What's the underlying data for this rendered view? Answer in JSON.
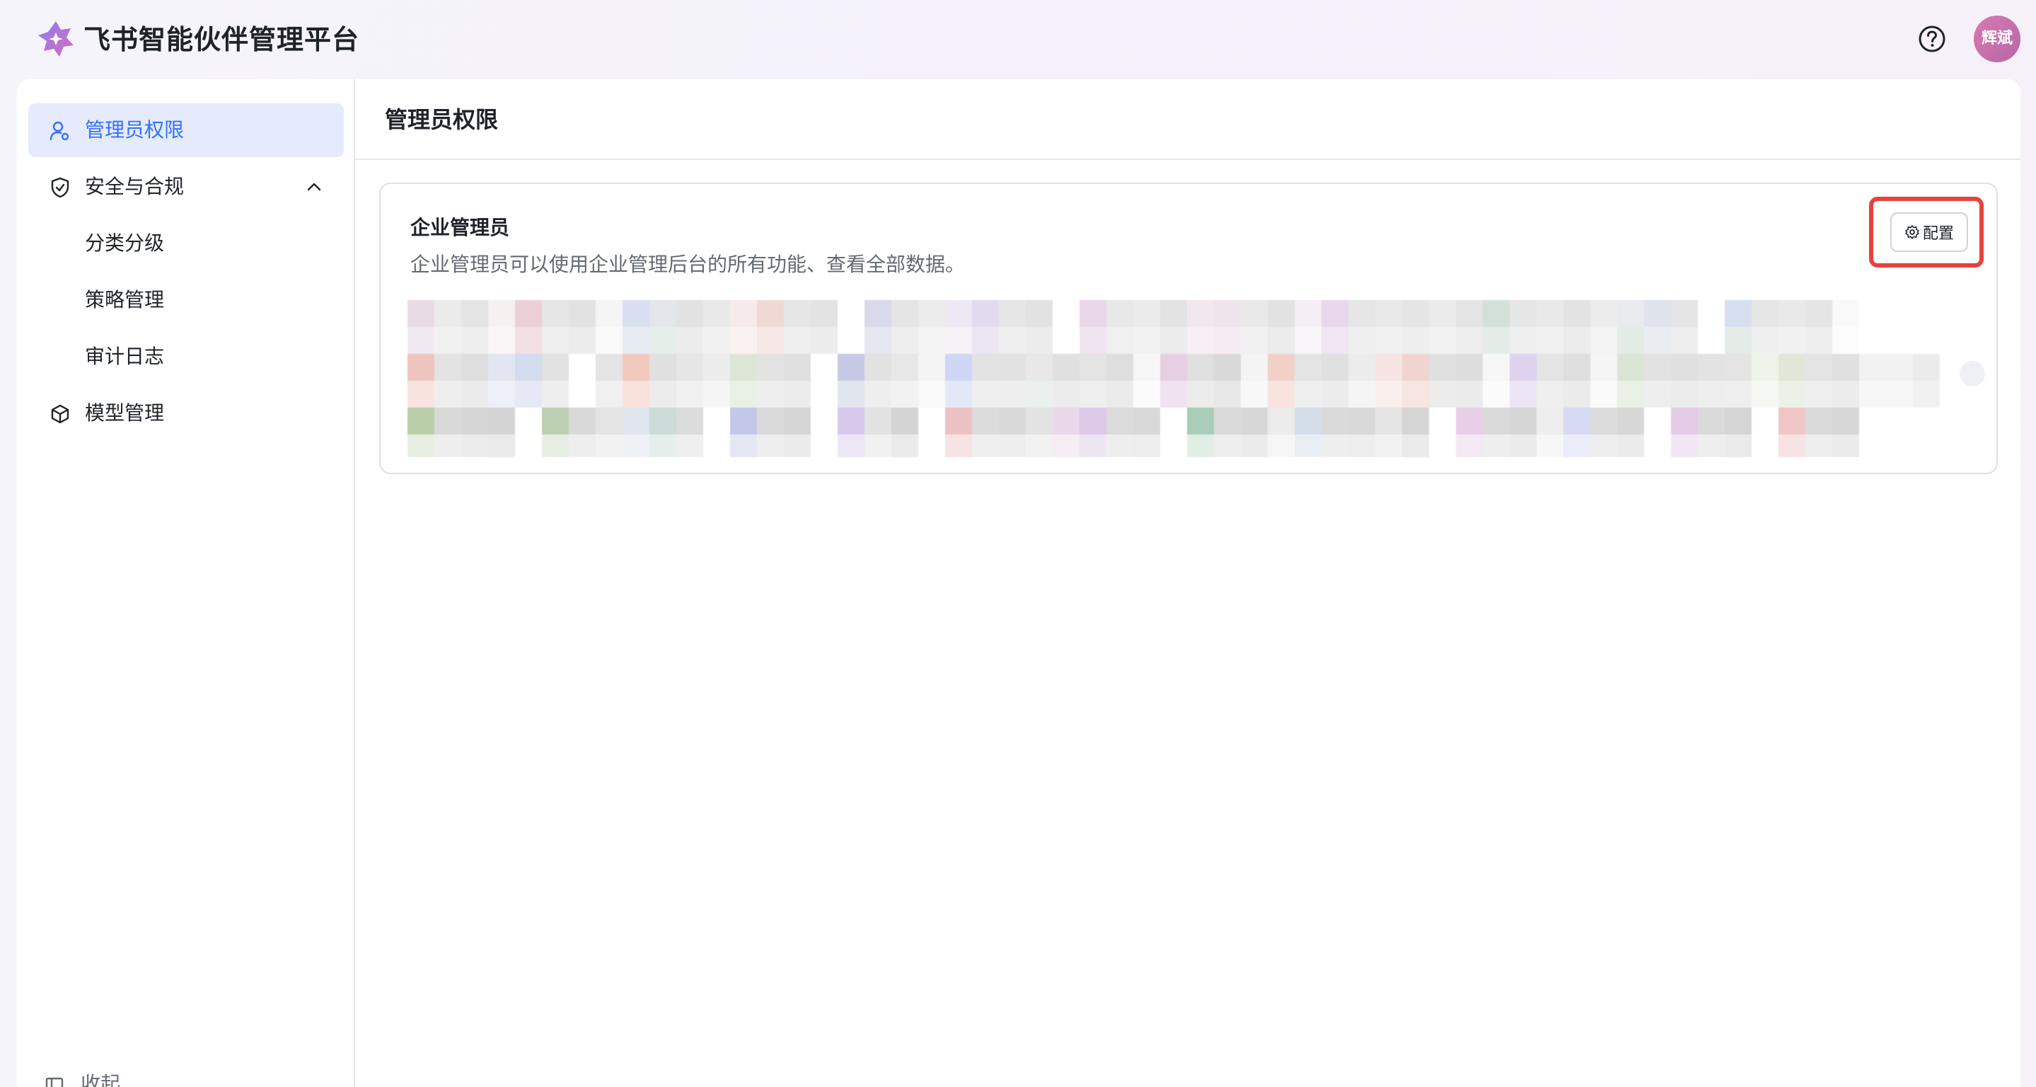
{
  "header": {
    "app_title": "飞书智能伙伴管理平台",
    "avatar_text": "辉斌",
    "help_icon": "help-circle-icon",
    "logo_icon": "feishu-logo"
  },
  "sidebar": {
    "items": [
      {
        "label": "管理员权限",
        "icon": "user-settings-icon",
        "active": true
      },
      {
        "label": "安全与合规",
        "icon": "shield-check-icon",
        "expanded": true
      },
      {
        "label": "分类分级"
      },
      {
        "label": "策略管理"
      },
      {
        "label": "审计日志"
      },
      {
        "label": "模型管理",
        "icon": "cube-icon"
      }
    ],
    "bottom_label": "收起"
  },
  "main": {
    "page_title": "管理员权限",
    "card": {
      "title": "企业管理员",
      "description": "企业管理员可以使用企业管理后台的所有功能、查看全部数据。",
      "config_button": "配置"
    }
  },
  "colors": {
    "accent": "#3370ff",
    "active_bg": "#e5ebfd",
    "highlight_border": "#e8413c"
  }
}
